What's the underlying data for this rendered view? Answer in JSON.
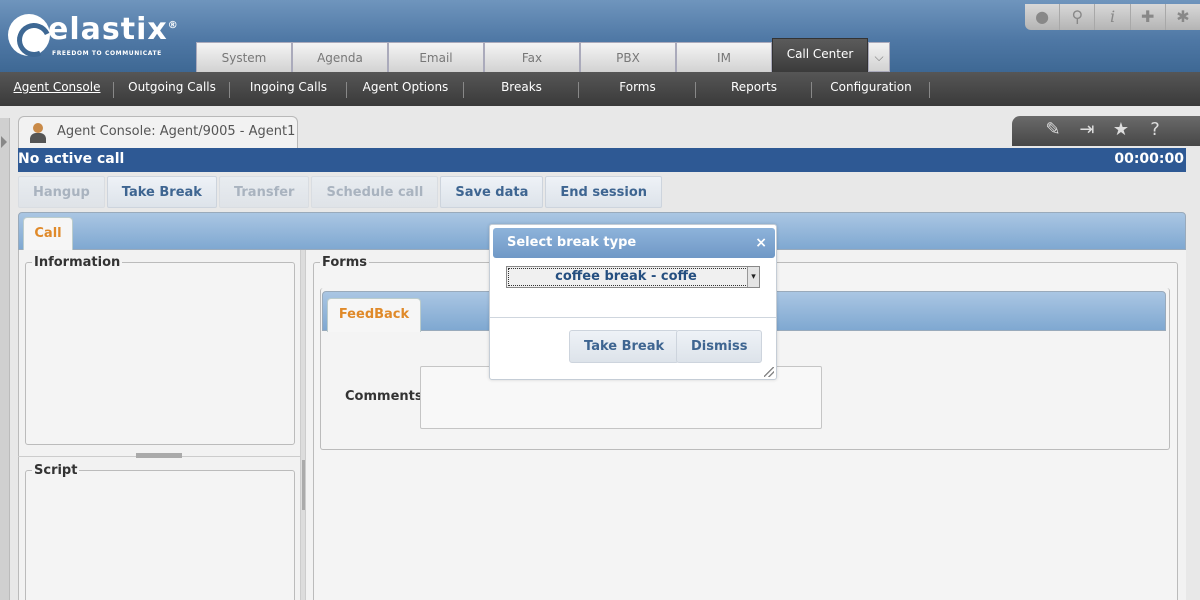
{
  "brand": {
    "name": "elastix",
    "tagline": "FREEDOM TO COMMUNICATE",
    "reg": "®"
  },
  "top_icons": [
    "drop-icon",
    "search-icon",
    "info-icon",
    "puzzle-icon",
    "gear-icon"
  ],
  "main_tabs": [
    {
      "label": "System"
    },
    {
      "label": "Agenda"
    },
    {
      "label": "Email"
    },
    {
      "label": "Fax"
    },
    {
      "label": "PBX"
    },
    {
      "label": "IM"
    },
    {
      "label": "Call Center",
      "active": true
    }
  ],
  "submenu": [
    {
      "label": "Agent Console",
      "active": true
    },
    {
      "label": "Outgoing Calls"
    },
    {
      "label": "Ingoing Calls"
    },
    {
      "label": "Agent Options"
    },
    {
      "label": "Breaks"
    },
    {
      "label": "Forms"
    },
    {
      "label": "Reports"
    },
    {
      "label": "Configuration"
    }
  ],
  "module": {
    "title": "Agent Console: Agent/9005 - Agent1"
  },
  "right_tools": [
    "edit-icon",
    "export-icon",
    "star-icon",
    "help-icon"
  ],
  "status": {
    "text": "No active call",
    "timer": "00:00:00"
  },
  "actions": [
    {
      "label": "Hangup",
      "enabled": false
    },
    {
      "label": "Take Break",
      "enabled": true
    },
    {
      "label": "Transfer",
      "enabled": false
    },
    {
      "label": "Schedule call",
      "enabled": false
    },
    {
      "label": "Save data",
      "enabled": true
    },
    {
      "label": "End session",
      "enabled": true
    }
  ],
  "call_tab": "Call",
  "panels": {
    "information": "Information",
    "script": "Script",
    "forms": "Forms"
  },
  "form_tab": "FeedBack",
  "comments_label": "Comments:",
  "modal": {
    "title": "Select break type",
    "close": "×",
    "selected_break": "coffee break - coffe",
    "take_break": "Take Break",
    "dismiss": "Dismiss"
  },
  "colors": {
    "accent": "#2e5994",
    "tab_orange": "#e08a2a",
    "button_text": "#3e6591"
  }
}
